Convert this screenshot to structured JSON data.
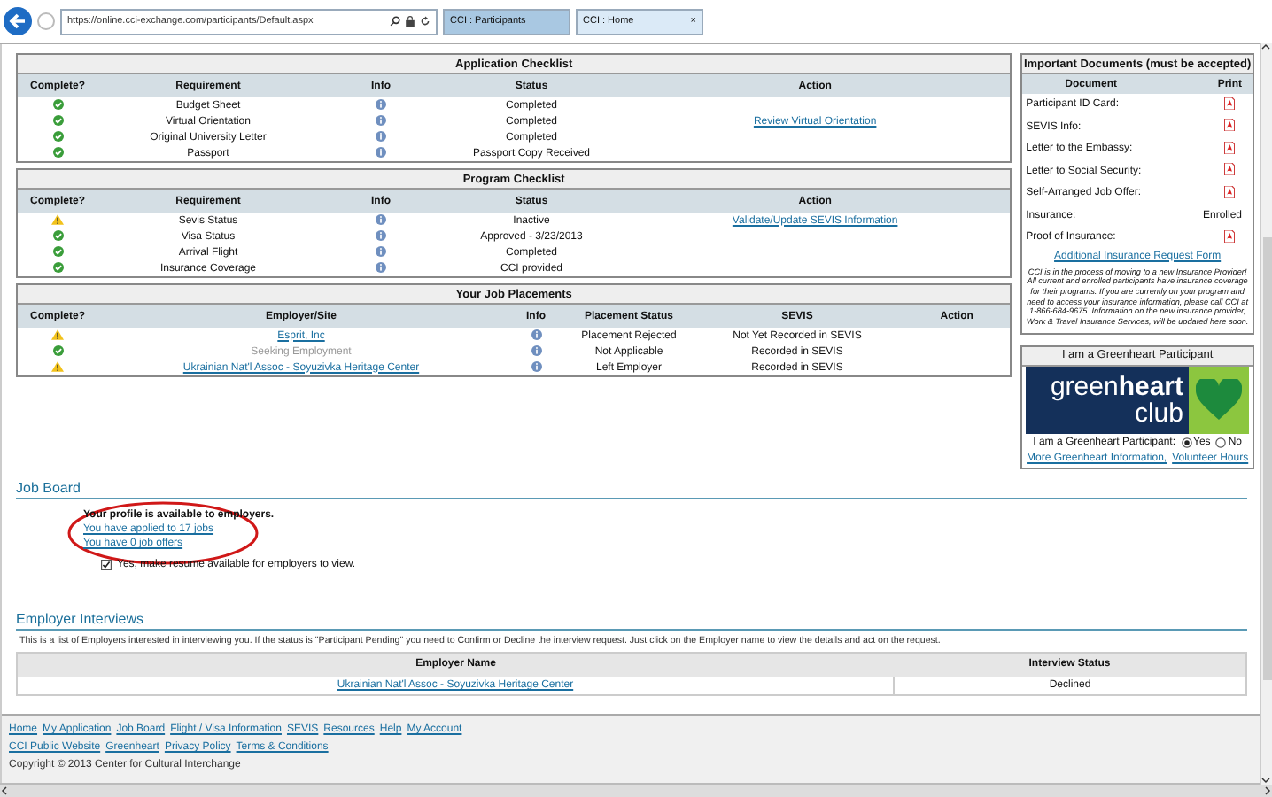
{
  "browser": {
    "url": "https://online.cci-exchange.com/participants/Default.aspx",
    "tabs": [
      {
        "title": "CCI : Participants",
        "selected": true
      },
      {
        "title": "CCI : Home",
        "selected": false,
        "close": "×"
      }
    ]
  },
  "application_checklist": {
    "title": "Application Checklist",
    "columns": [
      "Complete?",
      "Requirement",
      "Info",
      "Status",
      "Action"
    ],
    "rows": [
      {
        "complete": true,
        "requirement": "Budget Sheet",
        "status": "Completed"
      },
      {
        "complete": true,
        "requirement": "Virtual Orientation",
        "status": "Completed",
        "action": "Review Virtual Orientation"
      },
      {
        "complete": true,
        "requirement": "Original University Letter",
        "status": "Completed"
      },
      {
        "complete": true,
        "requirement": "Passport",
        "status": "Passport Copy Received"
      }
    ]
  },
  "program_checklist": {
    "title": "Program Checklist",
    "columns": [
      "Complete?",
      "Requirement",
      "Info",
      "Status",
      "Action"
    ],
    "rows": [
      {
        "complete": false,
        "requirement": "Sevis Status",
        "status": "Inactive",
        "action": "Validate/Update SEVIS Information"
      },
      {
        "complete": true,
        "requirement": "Visa Status",
        "status": "Approved - 3/23/2013"
      },
      {
        "complete": true,
        "requirement": "Arrival Flight",
        "status": "Completed"
      },
      {
        "complete": true,
        "requirement": "Insurance Coverage",
        "status": "CCI provided"
      }
    ]
  },
  "job_placements": {
    "title": "Your Job Placements",
    "columns": [
      "Complete?",
      "Employer/Site",
      "Info",
      "Placement Status",
      "SEVIS",
      "Action"
    ],
    "rows": [
      {
        "complete": false,
        "employer": "Esprit, Inc",
        "linked": true,
        "placement_status": "Placement Rejected",
        "sevis": "Not Yet Recorded in SEVIS"
      },
      {
        "complete": true,
        "employer": "Seeking Employment",
        "linked": false,
        "placement_status": "Not Applicable",
        "sevis": "Recorded in SEVIS"
      },
      {
        "complete": false,
        "employer": "Ukrainian Nat'l Assoc - Soyuzivka Heritage Center",
        "linked": true,
        "placement_status": "Left Employer",
        "sevis": "Recorded in SEVIS"
      }
    ]
  },
  "documents": {
    "title": "Important Documents (must be accepted)",
    "columns": [
      "Document",
      "Print"
    ],
    "rows": [
      {
        "document": "Participant ID Card:",
        "kind": "pdf"
      },
      {
        "document": "SEVIS Info:",
        "kind": "pdf"
      },
      {
        "document": "Letter to the Embassy:",
        "kind": "pdf"
      },
      {
        "document": "Letter to Social Security:",
        "kind": "pdf"
      },
      {
        "document": "Self-Arranged Job Offer:",
        "kind": "pdf"
      },
      {
        "document": "Insurance:",
        "kind": "text",
        "print": "Enrolled"
      },
      {
        "document": "Proof of Insurance:",
        "kind": "pdf"
      }
    ],
    "link": "Additional Insurance Request Form",
    "notice": "CCI is in the process of moving to a new Insurance Provider! All current and enrolled participants have insurance coverage for their programs. If you are currently on your program and need to access your insurance information, please call CCI at 1-866-684-9675. Information on the new insurance provider, Work & Travel Insurance Services, will be updated here soon."
  },
  "greenheart": {
    "title": "I am a Greenheart Participant",
    "logo": "green**heart**",
    "logo_sub": "club",
    "question": "I am a Greenheart Participant:",
    "options": [
      {
        "label": "Yes",
        "selected": true
      },
      {
        "label": "No",
        "selected": false
      }
    ],
    "links": [
      "More Greenheart Information,",
      "Volunteer Hours"
    ]
  },
  "job_board": {
    "title": "Job Board",
    "profile": "Your profile is available to employers.",
    "links": [
      "You have applied to 17 jobs",
      "You have 0 job offers"
    ],
    "resume": {
      "label": "Yes, make resume available for employers to view.",
      "checked": true
    }
  },
  "interviews": {
    "title": "Employer Interviews",
    "intro": "This is a list of Employers interested in interviewing you. If the status is \"Participant Pending\" you need to Confirm or Decline the interview request. Just click on the Employer name to view the details and act on the request.",
    "columns": [
      "Employer Name",
      "Interview Status"
    ],
    "rows": [
      {
        "employer": "Ukrainian Nat'l Assoc - Soyuzivka Heritage Center",
        "status": "Declined"
      }
    ]
  },
  "footer": {
    "links": [
      "Home",
      "My Application",
      "Job Board",
      "Flight / Visa Information",
      "SEVIS",
      "Resources",
      "Help",
      "My Account"
    ],
    "links_2": [
      "CCI Public Website",
      "Greenheart",
      "Privacy Policy",
      "Terms & Conditions"
    ],
    "copyright": "Copyright © 2013 Center for Cultural Interchange"
  }
}
